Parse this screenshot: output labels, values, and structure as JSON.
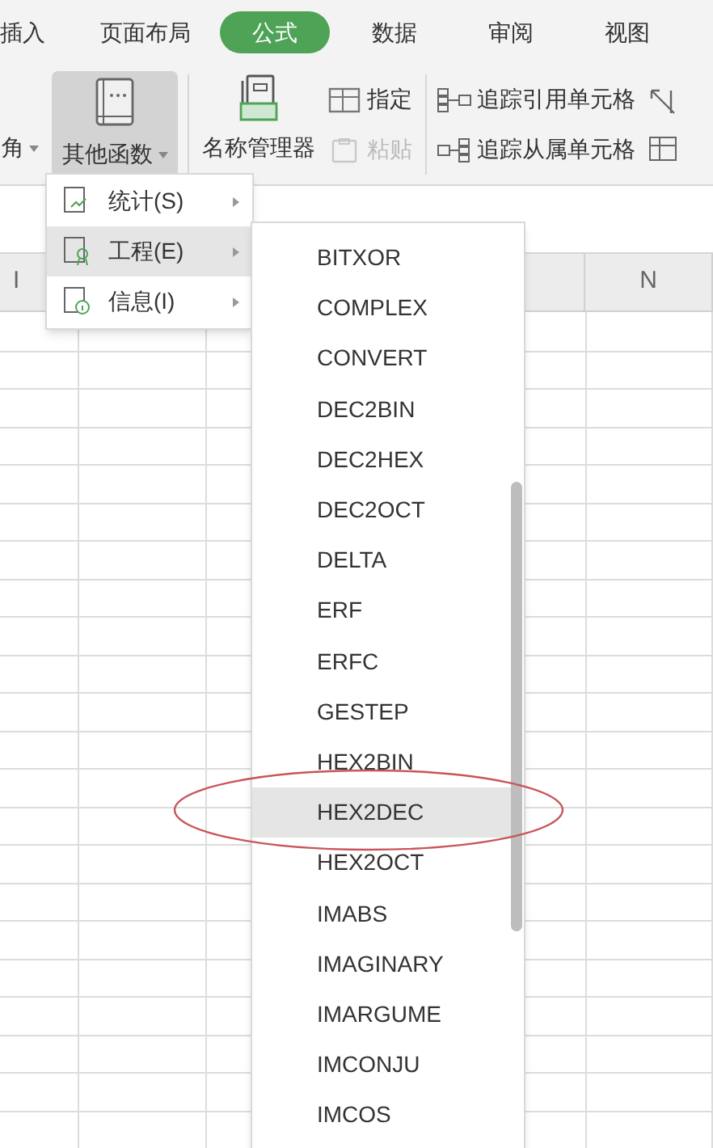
{
  "tabs": [
    {
      "label": "插入",
      "selected": false
    },
    {
      "label": "页面布局",
      "selected": false
    },
    {
      "label": "公式",
      "selected": true
    },
    {
      "label": "数据",
      "selected": false
    },
    {
      "label": "审阅",
      "selected": false
    },
    {
      "label": "视图",
      "selected": false
    }
  ],
  "ribbon": {
    "cut_button": {
      "label": "角"
    },
    "functions_button": {
      "label": "其他函数",
      "pressed": true
    },
    "name_manager": {
      "label": "名称管理器"
    },
    "name_buttons": [
      {
        "label": "指定",
        "disabled": false
      },
      {
        "label": "粘贴",
        "disabled": true
      }
    ],
    "trace_buttons": [
      {
        "label": "追踪引用单元格"
      },
      {
        "label": "追踪从属单元格"
      }
    ]
  },
  "sheet": {
    "column_headers": [
      "I",
      "N"
    ]
  },
  "menu": {
    "items": [
      {
        "label": "统计(S)",
        "selected": false
      },
      {
        "label": "工程(E)",
        "selected": true
      },
      {
        "label": "信息(I)",
        "selected": false
      }
    ]
  },
  "submenu": {
    "items": [
      {
        "label": "BITXOR",
        "selected": false
      },
      {
        "label": "COMPLEX",
        "selected": false
      },
      {
        "label": "CONVERT",
        "selected": false
      },
      {
        "label": "DEC2BIN",
        "selected": false
      },
      {
        "label": "DEC2HEX",
        "selected": false
      },
      {
        "label": "DEC2OCT",
        "selected": false
      },
      {
        "label": "DELTA",
        "selected": false
      },
      {
        "label": "ERF",
        "selected": false
      },
      {
        "label": "ERFC",
        "selected": false
      },
      {
        "label": "GESTEP",
        "selected": false
      },
      {
        "label": "HEX2BIN",
        "selected": false
      },
      {
        "label": "HEX2DEC",
        "selected": true
      },
      {
        "label": "HEX2OCT",
        "selected": false
      },
      {
        "label": "IMABS",
        "selected": false
      },
      {
        "label": "IMAGINARY",
        "selected": false
      },
      {
        "label": "IMARGUME",
        "selected": false
      },
      {
        "label": "IMCONJU",
        "selected": false
      },
      {
        "label": "IMCOS",
        "selected": false
      }
    ]
  }
}
